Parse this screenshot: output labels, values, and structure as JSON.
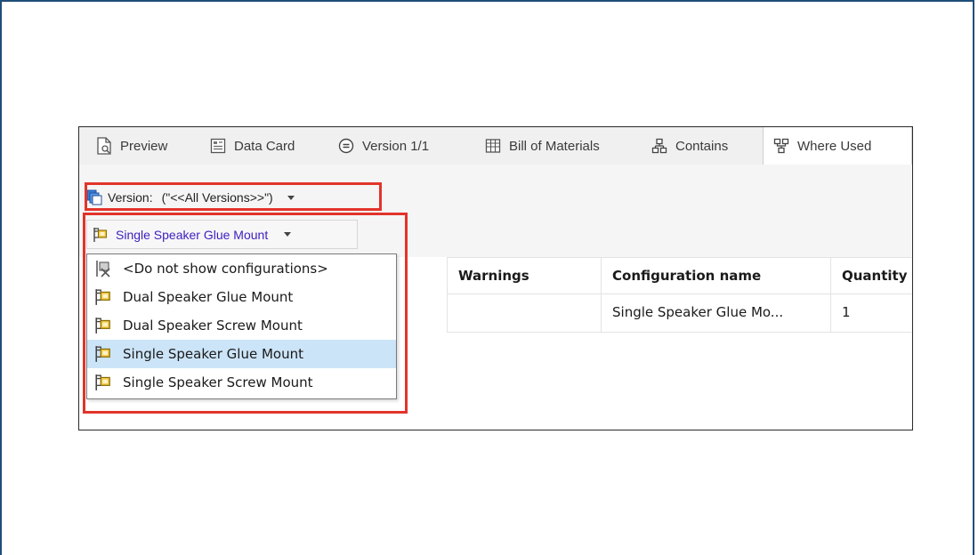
{
  "tabs": [
    {
      "label": "Preview",
      "icon": "preview-icon"
    },
    {
      "label": "Data Card",
      "icon": "data-card-icon"
    },
    {
      "label": "Version 1/1",
      "icon": "version-icon"
    },
    {
      "label": "Bill of Materials",
      "icon": "bill-of-materials-icon"
    },
    {
      "label": "Contains",
      "icon": "contains-icon"
    },
    {
      "label": "Where Used",
      "icon": "where-used-icon",
      "active": true
    }
  ],
  "version_selector": {
    "label": "Version:",
    "value": "(\"<<All Versions>>\")"
  },
  "config_selector": {
    "value": "Single Speaker Glue Mount"
  },
  "config_options": [
    {
      "label": "<Do not show configurations>",
      "icon": "no-configurations-icon"
    },
    {
      "label": "Dual Speaker Glue Mount",
      "icon": "configuration-flag-icon"
    },
    {
      "label": "Dual Speaker Screw Mount",
      "icon": "configuration-flag-icon"
    },
    {
      "label": "Single Speaker Glue Mount",
      "icon": "configuration-flag-icon",
      "selected": true
    },
    {
      "label": "Single Speaker Screw Mount",
      "icon": "configuration-flag-icon"
    }
  ],
  "table": {
    "columns": [
      "Warnings",
      "Configuration name",
      "Quantity"
    ],
    "rows": [
      [
        "",
        "Single Speaker Glue Mo...",
        "1"
      ]
    ]
  },
  "colors": {
    "highlight_box": "#e2342a",
    "selected_row": "#cce4f7",
    "config_text": "#3c1fbf",
    "frame_border": "#1f4e79"
  }
}
